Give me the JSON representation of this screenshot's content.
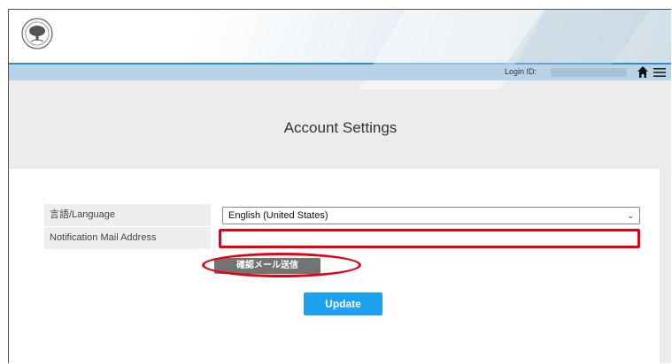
{
  "header": {
    "login_label": "Login ID:"
  },
  "page": {
    "title": "Account Settings"
  },
  "form": {
    "language_label": "言語/Language",
    "language_value": "English (United States)",
    "mail_label": "Notification Mail Address",
    "mail_value": "",
    "send_confirm_button": "確認メール送信",
    "update_button": "Update"
  },
  "colors": {
    "accent": "#1ea2f0",
    "highlight": "#e60012",
    "login_bar": "#b8d3e7"
  },
  "icons": [
    "logo-emblem-icon",
    "home-icon",
    "hamburger-menu-icon",
    "chevron-down-icon"
  ]
}
